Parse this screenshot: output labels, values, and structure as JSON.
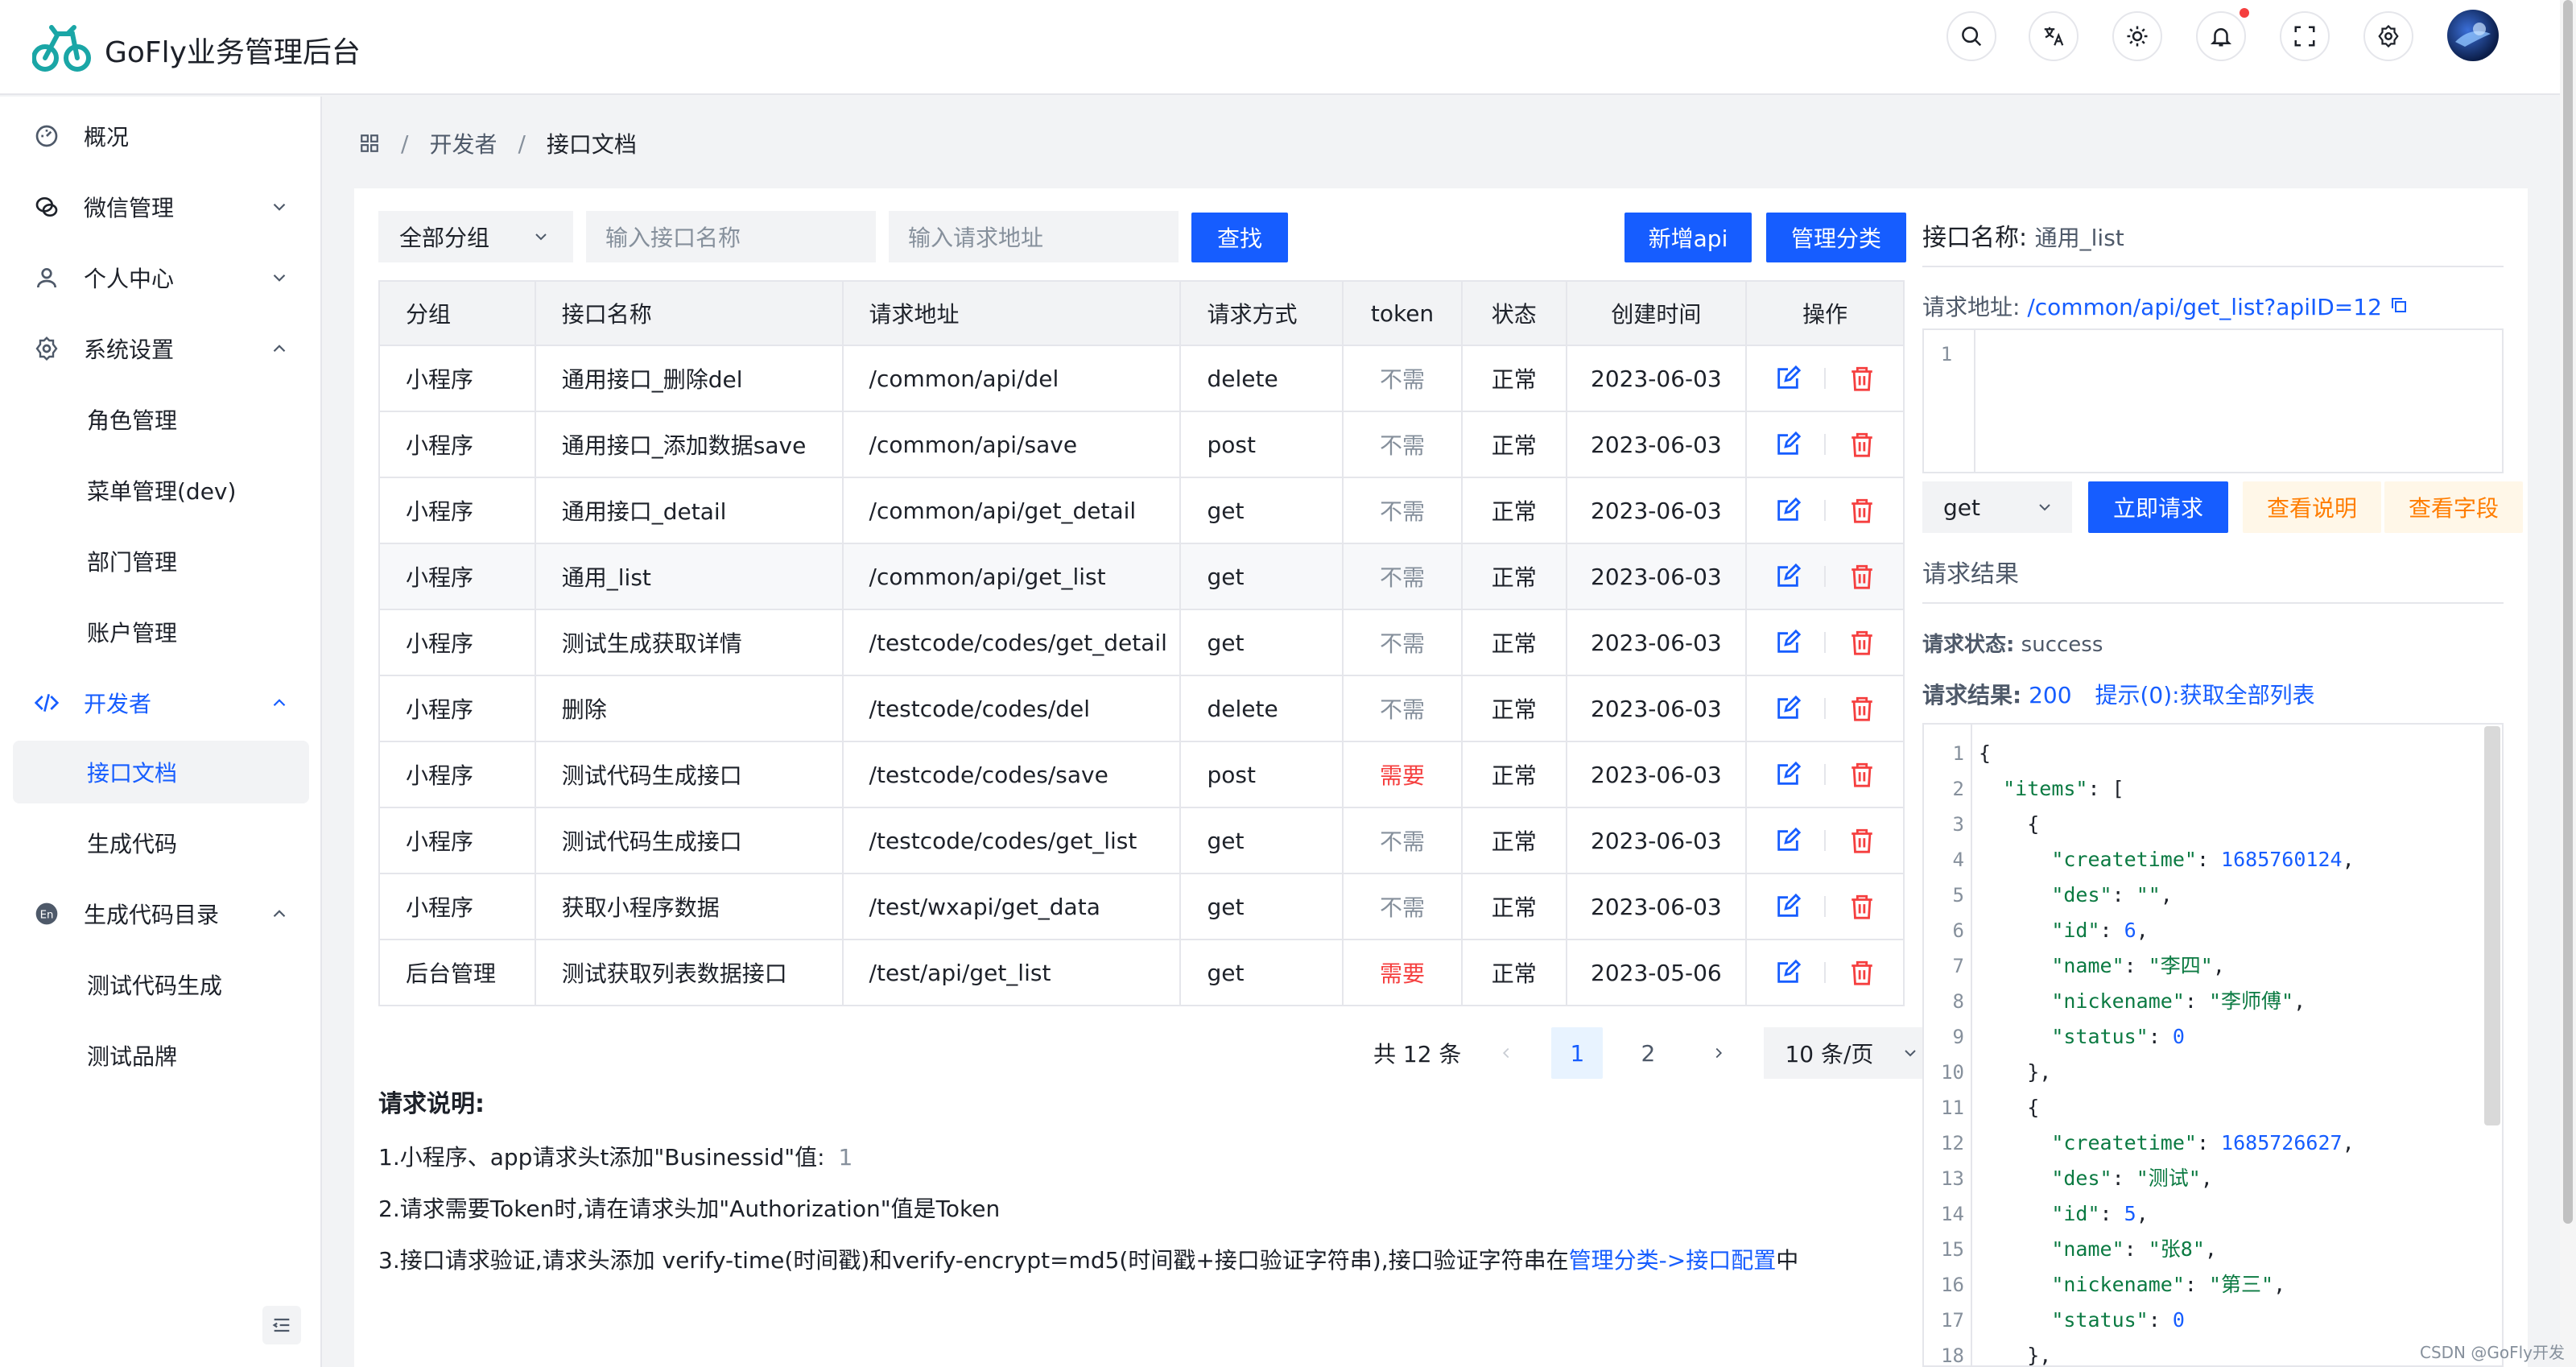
{
  "app": {
    "title": "GoFly业务管理后台"
  },
  "header": {
    "icons": [
      "search-icon",
      "translate-icon",
      "theme-icon",
      "bell-icon",
      "fullscreen-icon",
      "settings-icon"
    ]
  },
  "sidebar": {
    "items": [
      {
        "label": "概况",
        "icon": "dashboard-icon"
      },
      {
        "label": "微信管理",
        "icon": "wechat-icon"
      },
      {
        "label": "个人中心",
        "icon": "user-icon"
      },
      {
        "label": "系统设置",
        "icon": "gear-icon"
      },
      {
        "label": "角色管理"
      },
      {
        "label": "菜单管理(dev)"
      },
      {
        "label": "部门管理"
      },
      {
        "label": "账户管理"
      },
      {
        "label": "开发者",
        "icon": "code-icon"
      },
      {
        "label": "接口文档"
      },
      {
        "label": "生成代码"
      },
      {
        "label": "生成代码目录",
        "icon": "en-icon"
      },
      {
        "label": "测试代码生成"
      },
      {
        "label": "测试品牌"
      }
    ]
  },
  "breadcrumb": {
    "level1": "开发者",
    "level2": "接口文档"
  },
  "filters": {
    "group_select": "全部分组",
    "name_placeholder": "输入接口名称",
    "url_placeholder": "输入请求地址",
    "search_label": "查找",
    "add_label": "新增api",
    "manage_label": "管理分类"
  },
  "table": {
    "headers": [
      "分组",
      "接口名称",
      "请求地址",
      "请求方式",
      "token",
      "状态",
      "创建时间",
      "操作"
    ],
    "rows": [
      [
        "小程序",
        "通用接口_删除del",
        "/common/api/del",
        "delete",
        "不需",
        "正常",
        "2023-06-03"
      ],
      [
        "小程序",
        "通用接口_添加数据save",
        "/common/api/save",
        "post",
        "不需",
        "正常",
        "2023-06-03"
      ],
      [
        "小程序",
        "通用接口_detail",
        "/common/api/get_detail",
        "get",
        "不需",
        "正常",
        "2023-06-03"
      ],
      [
        "小程序",
        "通用_list",
        "/common/api/get_list",
        "get",
        "不需",
        "正常",
        "2023-06-03"
      ],
      [
        "小程序",
        "测试生成获取详情",
        "/testcode/codes/get_detail",
        "get",
        "不需",
        "正常",
        "2023-06-03"
      ],
      [
        "小程序",
        "删除",
        "/testcode/codes/del",
        "delete",
        "不需",
        "正常",
        "2023-06-03"
      ],
      [
        "小程序",
        "测试代码生成接口",
        "/testcode/codes/save",
        "post",
        "需要",
        "正常",
        "2023-06-03"
      ],
      [
        "小程序",
        "测试代码生成接口",
        "/testcode/codes/get_list",
        "get",
        "不需",
        "正常",
        "2023-06-03"
      ],
      [
        "小程序",
        "获取小程序数据",
        "/test/wxapi/get_data",
        "get",
        "不需",
        "正常",
        "2023-06-03"
      ],
      [
        "后台管理",
        "测试获取列表数据接口",
        "/test/api/get_list",
        "get",
        "需要",
        "正常",
        "2023-05-06"
      ]
    ]
  },
  "pagination": {
    "total": "共 12 条",
    "pages": [
      "1",
      "2"
    ],
    "page_size": "10 条/页"
  },
  "notes": {
    "title": "请求说明:",
    "line1_prefix": "1.小程序、app请求头t添加\"Businessid\"值:",
    "line1_value": "1",
    "line2": "2.请求需要Token时,请在请求头加\"Authorization\"值是Token",
    "line3_prefix": "3.接口请求验证,请求头添加 verify-time(时间戳)和verify-encrypt=md5(时间戳+接口验证字符串),接口验证字符串在",
    "line3_link": "管理分类->接口配置",
    "line3_suffix": "中"
  },
  "detail": {
    "name_label": "接口名称:",
    "name_value": "通用_list",
    "url_label": "请求地址:",
    "url_value": "/common/api/get_list?apiID=12",
    "editor_line": "1",
    "method": "get",
    "send_label": "立即请求",
    "doc_label": "查看说明",
    "fields_label": "查看字段",
    "result_title": "请求结果",
    "status_label": "请求状态:",
    "status_value": "success",
    "result_label": "请求结果:",
    "result_code": "200",
    "result_msg": "提示(0):获取全部列表"
  },
  "code": {
    "lines": [
      "{",
      "  \"items\": [",
      "    {",
      "      \"createtime\": 1685760124,",
      "      \"des\": \"\",",
      "      \"id\": 6,",
      "      \"name\": \"李四\",",
      "      \"nickename\": \"李师傅\",",
      "      \"status\": 0",
      "    },",
      "    {",
      "      \"createtime\": 1685726627,",
      "      \"des\": \"测试\",",
      "      \"id\": 5,",
      "      \"name\": \"张8\",",
      "      \"nickename\": \"第三\",",
      "      \"status\": 0",
      "    },"
    ]
  },
  "watermark": "CSDN @GoFly开发者"
}
